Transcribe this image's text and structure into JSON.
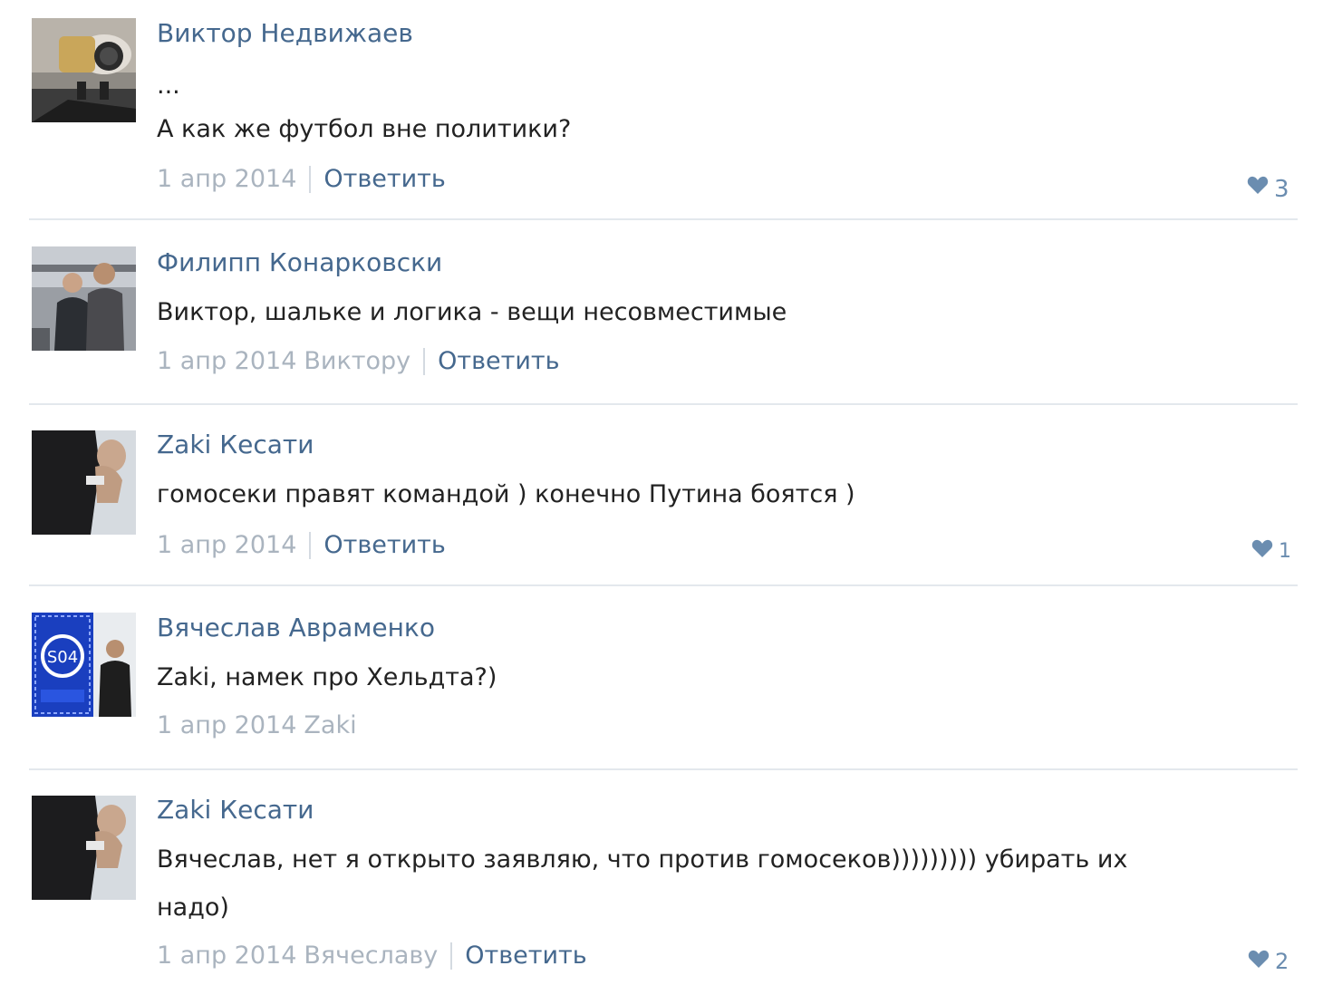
{
  "comments": [
    {
      "author": "Виктор Недвижаев",
      "ellipsis": "...",
      "text": "А как же футбол вне политики?",
      "date": "1 апр 2014",
      "reply_to": "",
      "reply_label": "Ответить",
      "likes": "3",
      "avatar_icon": "avatar-photo-watch"
    },
    {
      "author": "Филипп Конарковски",
      "text": "Виктор, шальке и логика - вещи несовместимые",
      "date": "1 апр 2014",
      "reply_to": "Виктору",
      "reply_label": "Ответить",
      "likes": "",
      "avatar_icon": "avatar-photo-two-men"
    },
    {
      "author": "Zaki Кесати",
      "text": "гомосеки правят командой ) конечно Путина боятся )",
      "date": "1 апр 2014",
      "reply_to": "",
      "reply_label": "Ответить",
      "likes": "1",
      "avatar_icon": "avatar-photo-man-phone"
    },
    {
      "author": "Вячеслав Авраменко",
      "text": "Zaki, намек про Хельдта?)",
      "date": "1 апр 2014",
      "reply_to": "Zaki",
      "reply_label": "",
      "likes": "",
      "avatar_icon": "avatar-photo-schalke-flag"
    },
    {
      "author": "Zaki Кесати",
      "text_line1": "Вячеслав, нет я открыто заявляю, что против гомосеков))))))))) убирать их",
      "text_line2": "надо)",
      "date": "1 апр 2014",
      "reply_to": "Вячеславу",
      "reply_label": "Ответить",
      "likes": "2",
      "avatar_icon": "avatar-photo-man-phone"
    }
  ],
  "colors": {
    "link": "#45688e",
    "meta": "#aab4bf",
    "heart": "#6b8db0",
    "divider": "#e3e8ed"
  }
}
